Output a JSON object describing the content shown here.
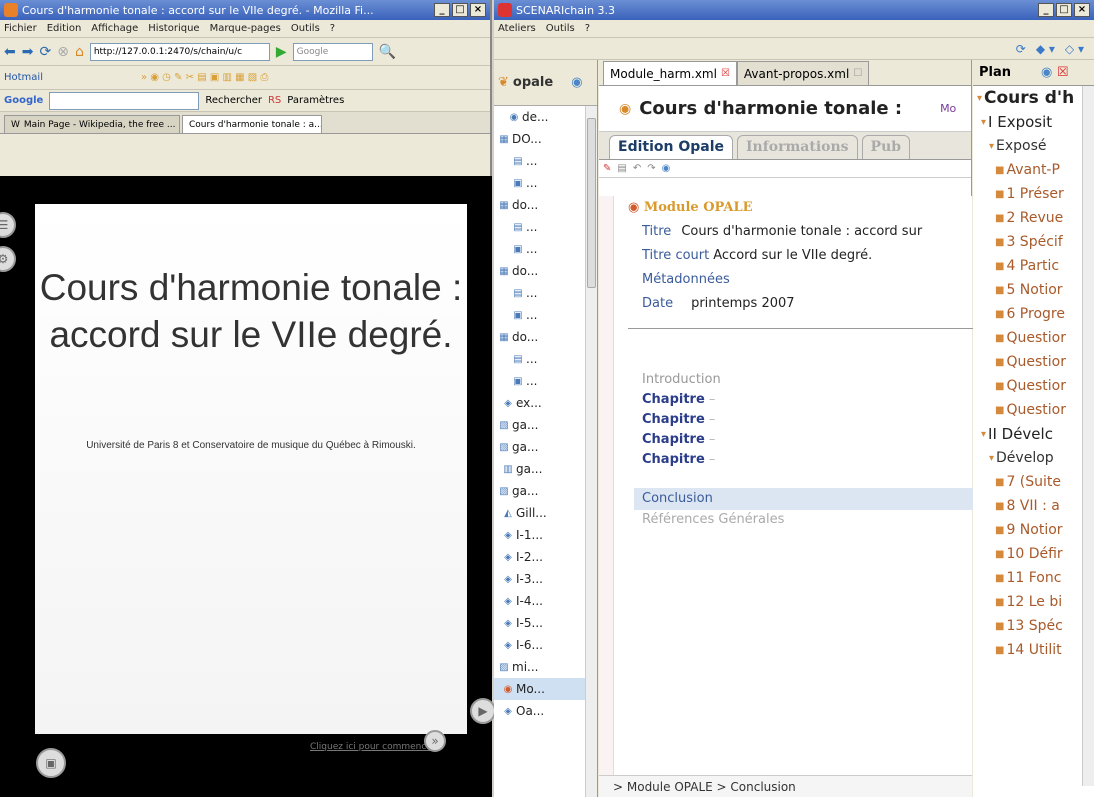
{
  "firefox": {
    "title": "Cours d'harmonie tonale : accord sur le VIIe degré. - Mozilla Fi...",
    "menu": [
      "Fichier",
      "Edition",
      "Affichage",
      "Historique",
      "Marque-pages",
      "Outils",
      "?"
    ],
    "url": "http://127.0.0.1:2470/s/chain/u/c",
    "search_engine": "Google",
    "bookmarks": [
      "Hotmail"
    ],
    "google_toolbar": {
      "label": "Google",
      "search_btn": "Rechercher",
      "rs": "RS",
      "params": "Paramètres"
    },
    "tabs": [
      "Main Page - Wikipedia, the free ...",
      "Cours d'harmonie tonale : a..."
    ],
    "slide": {
      "title": "Cours d'harmonie tonale : accord sur le VIIe degré.",
      "subtitle": "Université de Paris 8 et Conservatoire de musique du Québec à Rimouski.",
      "start_link": "Cliquez ici pour commencer"
    }
  },
  "scenari": {
    "title": "SCENARIchain 3.3",
    "menu": [
      "Ateliers",
      "Outils",
      "?"
    ],
    "tree": {
      "header": "opale",
      "items": [
        "de...",
        "DO...",
        "...",
        "...",
        "do...",
        "...",
        "...",
        "do...",
        "...",
        "...",
        "do...",
        "...",
        "...",
        "ex...",
        "ga...",
        "ga...",
        "ga...",
        "ga...",
        "Gill...",
        "I-1...",
        "I-2...",
        "I-3...",
        "I-4...",
        "I-5...",
        "I-6...",
        "mi...",
        "Mo...",
        "Oa..."
      ]
    },
    "editor": {
      "tabs": [
        "Module_harm.xml",
        "Avant-propos.xml"
      ],
      "doc_title": "Cours d'harmonie tonale :",
      "doc_title_line2": "accord sur le VIIe degré.",
      "doc_badge": "Mo",
      "mode_tabs": [
        "Edition Opale",
        "Informations",
        "Pub"
      ],
      "module_label": "Module OPALE",
      "fields": {
        "titre_label": "Titre",
        "titre_value": "Cours d'harmonie tonale : accord sur",
        "titre_court_label": "Titre court",
        "titre_court_value": "Accord sur le VIIe degré.",
        "metadonnees_label": "Métadonnées",
        "date_label": "Date",
        "date_value": "printemps 2007"
      },
      "introduction": "Introduction",
      "chapitres": [
        "Chapitre",
        "Chapitre",
        "Chapitre",
        "Chapitre"
      ],
      "conclusion": "Conclusion",
      "references": "Références Générales",
      "breadcrumb": "> Module OPALE > Conclusion"
    },
    "plan": {
      "header": "Plan",
      "items": [
        {
          "level": "h1",
          "text": "Cours d'h"
        },
        {
          "level": "h2",
          "text": "I Exposit"
        },
        {
          "level": "h3",
          "text": "Exposé"
        },
        {
          "level": "h4",
          "text": "Avant-P"
        },
        {
          "level": "h4",
          "text": "1 Préser"
        },
        {
          "level": "h4",
          "text": "2 Revue"
        },
        {
          "level": "h4",
          "text": "3 Spécif"
        },
        {
          "level": "h4",
          "text": "4 Partic"
        },
        {
          "level": "h4",
          "text": "5 Notior"
        },
        {
          "level": "h4",
          "text": "6 Progre"
        },
        {
          "level": "h4",
          "text": "Questior"
        },
        {
          "level": "h4",
          "text": "Questior"
        },
        {
          "level": "h4",
          "text": "Questior"
        },
        {
          "level": "h4",
          "text": "Questior"
        },
        {
          "level": "h2",
          "text": "II Dévelc"
        },
        {
          "level": "h3",
          "text": "Dévelop"
        },
        {
          "level": "h4",
          "text": "7 (Suite"
        },
        {
          "level": "h4",
          "text": "8 VII : a"
        },
        {
          "level": "h4",
          "text": "9 Notior"
        },
        {
          "level": "h4",
          "text": "10 Défir"
        },
        {
          "level": "h4",
          "text": "11 Fonc"
        },
        {
          "level": "h4",
          "text": "12 Le bi"
        },
        {
          "level": "h4",
          "text": "13 Spéc"
        },
        {
          "level": "h4",
          "text": "14 Utilit"
        }
      ]
    }
  }
}
